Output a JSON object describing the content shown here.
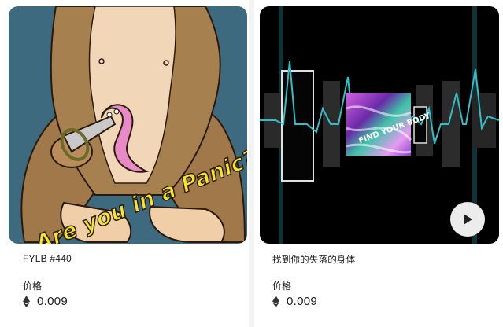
{
  "cards": [
    {
      "title": "FYLB #440",
      "artwork_text": "Are you in a Panic?",
      "price_label": "价格",
      "price": "0.009",
      "currency_icon": "ethereum-icon"
    },
    {
      "title": "找到你的失落的身体",
      "artwork_text": "FIND YOUR BODY",
      "price_label": "价格",
      "price": "0.009",
      "currency_icon": "ethereum-icon",
      "media_control_icon": "play-icon"
    }
  ],
  "colors": {
    "card1_background": "#3e6a80",
    "card2_background": "#000000",
    "waveform": "#2fbfc8",
    "caption_yellow": "#f5e626"
  }
}
